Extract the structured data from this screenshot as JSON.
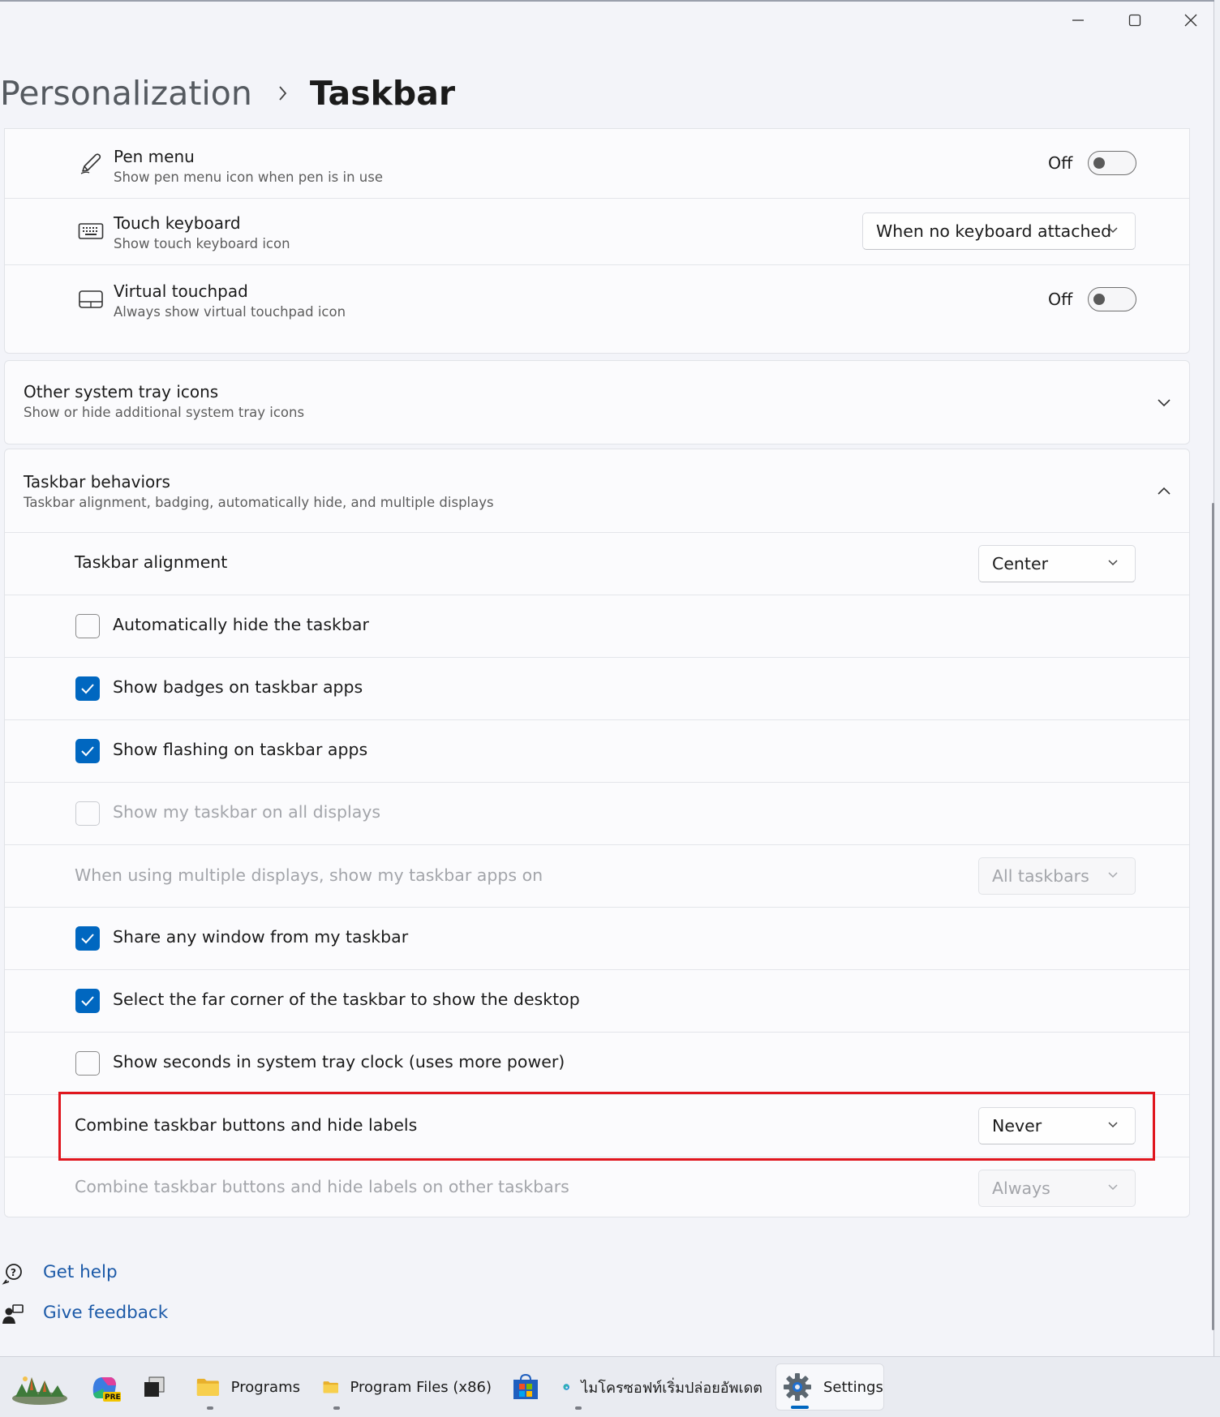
{
  "window": {
    "minimize_icon": "minimize-icon",
    "maximize_icon": "maximize-icon",
    "close_icon": "close-icon"
  },
  "breadcrumb": {
    "parent": "Personalization",
    "current": "Taskbar"
  },
  "pen_settings": [
    {
      "title": "Pen menu",
      "subtitle": "Show pen menu icon when pen is in use",
      "control": "toggle",
      "state": "Off"
    },
    {
      "title": "Touch keyboard",
      "subtitle": "Show touch keyboard icon",
      "control": "dropdown",
      "value": "When no keyboard attached"
    },
    {
      "title": "Virtual touchpad",
      "subtitle": "Always show virtual touchpad icon",
      "control": "toggle",
      "state": "Off"
    }
  ],
  "other_tray": {
    "title": "Other system tray icons",
    "subtitle": "Show or hide additional system tray icons",
    "expanded": false
  },
  "behaviors": {
    "title": "Taskbar behaviors",
    "subtitle": "Taskbar alignment, badging, automatically hide, and multiple displays",
    "expanded": true,
    "alignment": {
      "label": "Taskbar alignment",
      "value": "Center"
    },
    "checkboxes": [
      {
        "label": "Automatically hide the taskbar",
        "checked": false,
        "disabled": false
      },
      {
        "label": "Show badges on taskbar apps",
        "checked": true,
        "disabled": false
      },
      {
        "label": "Show flashing on taskbar apps",
        "checked": true,
        "disabled": false
      },
      {
        "label": "Show my taskbar on all displays",
        "checked": false,
        "disabled": true
      }
    ],
    "multi_display": {
      "label": "When using multiple displays, show my taskbar apps on",
      "value": "All taskbars",
      "disabled": true
    },
    "checkboxes2": [
      {
        "label": "Share any window from my taskbar",
        "checked": true,
        "disabled": false
      },
      {
        "label": "Select the far corner of the taskbar to show the desktop",
        "checked": true,
        "disabled": false
      },
      {
        "label": "Show seconds in system tray clock (uses more power)",
        "checked": false,
        "disabled": false
      }
    ],
    "combine": {
      "label": "Combine taskbar buttons and hide labels",
      "value": "Never"
    },
    "combine_other": {
      "label": "Combine taskbar buttons and hide labels on other taskbars",
      "value": "Always",
      "disabled": true
    }
  },
  "links": {
    "help": "Get help",
    "feedback": "Give feedback"
  },
  "taskbar": {
    "items": [
      {
        "label": "",
        "icon": "widgets-landscape-icon"
      },
      {
        "label": "",
        "icon": "copilot-pre-icon"
      },
      {
        "label": "",
        "icon": "task-view-icon"
      },
      {
        "label": "Programs",
        "icon": "folder-icon"
      },
      {
        "label": "Program Files (x86)",
        "icon": "folder-icon"
      },
      {
        "label": "",
        "icon": "microsoft-store-icon"
      },
      {
        "label": "ไมโครซอฟท์เริ่มปล่อยอัพเดต",
        "icon": "edge-icon"
      },
      {
        "label": "Settings",
        "icon": "settings-gear-icon"
      }
    ]
  },
  "colors": {
    "accent": "#0067c0",
    "highlight_box": "#e0161e",
    "link": "#1c5aa8"
  }
}
